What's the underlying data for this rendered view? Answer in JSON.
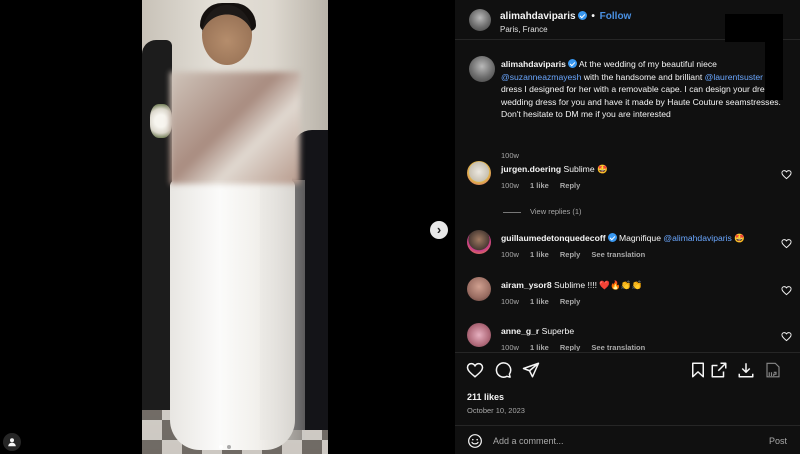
{
  "post": {
    "author": "alimahdaviparis",
    "follow_label": "Follow",
    "separator": "•",
    "location": "Paris, France",
    "more_label": "···",
    "likes": "211 likes",
    "date": "October 10, 2023"
  },
  "caption": {
    "user": "alimahdaviparis",
    "text_1": " At the wedding of my beautiful niece ",
    "mention_1": "@suzanneazmayesh",
    "text_2": " with the handsome and brilliant ",
    "mention_2": "@laurentsuster",
    "text_3": " in a dress I designed for her with a removable cape. I can design your dream wedding dress for you and have it made by Haute Couture seamstresses. Don't hesitate to DM me if you are interested",
    "time": "100w"
  },
  "comments": [
    {
      "user": "jurgen.doering",
      "text": "Sublime 🤩",
      "time": "100w",
      "likes": "1 like",
      "reply": "Reply",
      "translate": "",
      "avatar_color": "#d8d3c8"
    },
    {
      "user": "guillaumedetonquedecoff",
      "text": "Magnifique ",
      "mention": "@alimahdaviparis",
      "text_after": " 🤩",
      "time": "100w",
      "likes": "1 like",
      "reply": "Reply",
      "translate": "See translation",
      "avatar_color": "#4a3a33"
    },
    {
      "user": "airam_ysor8",
      "text": "Sublime !!!! ❤️🔥👏👏",
      "time": "100w",
      "likes": "1 like",
      "reply": "Reply",
      "translate": "",
      "avatar_color": "#9a6d62"
    },
    {
      "user": "anne_g_r",
      "text": "Superbe",
      "time": "100w",
      "likes": "1 like",
      "reply": "Reply",
      "translate": "See translation",
      "avatar_color": "#b06a7a"
    }
  ],
  "view_replies": "View replies (1)",
  "add_comment": {
    "placeholder": "Add a comment...",
    "post_label": "Post"
  },
  "carousel": {
    "next_label": "›",
    "slides": 2,
    "active_slide": 1
  },
  "colors": {
    "panel_bg": "#101010",
    "accent": "#4a90e2",
    "mention": "#6aa7ff",
    "muted": "#a8a8a8"
  },
  "icons": [
    "heart-icon",
    "comment-icon",
    "share-icon",
    "save-icon",
    "external-link-icon",
    "download-icon",
    "translate-icon",
    "emoji-icon",
    "user-tag-icon",
    "verified-badge-icon",
    "chevron-right-icon"
  ]
}
